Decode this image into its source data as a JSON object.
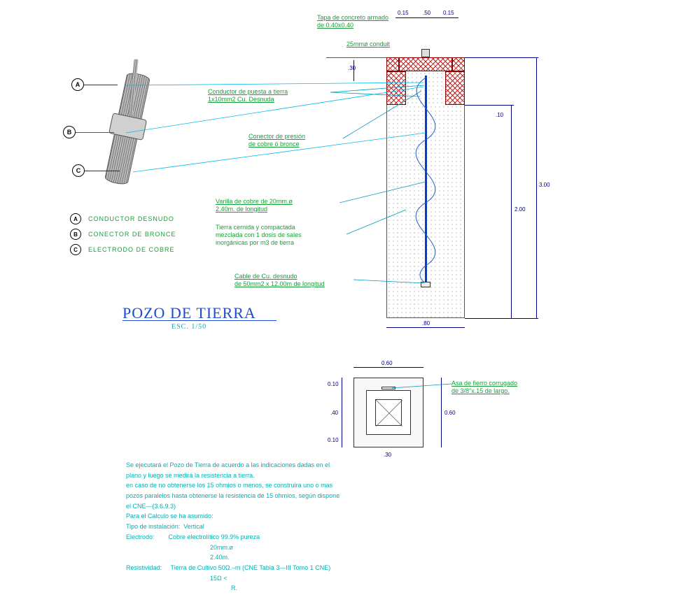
{
  "title": "POZO DE TIERRA",
  "scale": "ESC. 1/50",
  "annotations": {
    "tapa": "Tapa de concreto armado\nde 0.40x0.40",
    "conduit": "25mmø conduit",
    "conductor_puesta": "Conductor de puesta a tierra\n1x10mm2 Cu. Desnuda",
    "conector_presion": "Conector de presión\nde cobre ó bronce",
    "varilla": "Varilla de cobre de 20mm.ø\n2.40m. de longitud",
    "tierra_cernida": "Tierra cernida y compactada\nmezclada con 1 dosis de sales\ninorgánicas por m3 de tierra",
    "cable_cu": "Cable de Cu. desnudo\nde 50mm2 x 12.00m de longitud",
    "asa_fierro": "Asa de fierro corrugado\nde 3/8\"x.15 de largo."
  },
  "markers": {
    "a": "A",
    "b": "B",
    "c": "C"
  },
  "legend": {
    "a": "CONDUCTOR DESNUDO",
    "b": "CONECTOR DE BRONCE",
    "c": "ELECTRODO DE COBRE"
  },
  "dims_section": {
    "top_left": "0.15",
    "top_mid": ".50",
    "top_right": "0.15",
    "left_step": ".30",
    "right_seg1": ".10",
    "right_seg2": "2.00",
    "right_total": "3.00",
    "bottom": ".80"
  },
  "dims_plan": {
    "top_outer": "0.60",
    "left_seg1": "0.10",
    "left_seg2": ".40",
    "left_seg3": "0.10",
    "bottom_seg2": ".30",
    "right_total": "0.60"
  },
  "notes": {
    "l1": "Se ejecutará el Pozo de Tierra de acuerdo a las indicaciones dadas en el",
    "l2": "plano y luego se medirá la resistencia a tierra.",
    "l3": "en caso de no obtenerse los 15 ohmios o menos, se construira uno o mas",
    "l4": "pozos paralelos hasta obtenerse la resistencia de 15 ohmios, según dispone",
    "l5": "el CNE—(3.6.9.3)",
    "l6": "Para el Calculo se ha asumido:",
    "l7a": "Tipo de instalación:",
    "l7b": "Vertical",
    "l8a": "Electrodo:",
    "l8b": "Cobre electrolítico 99.9% pureza",
    "l9": "20mm.ø",
    "l10": "2.40m.",
    "l11a": "Resistividad:",
    "l11b": "Tierra de Cultivo 50Ω.–m (CNE Tabla 3—III Tomo 1 CNE)",
    "l12": "15Ω <",
    "l13": "R."
  }
}
